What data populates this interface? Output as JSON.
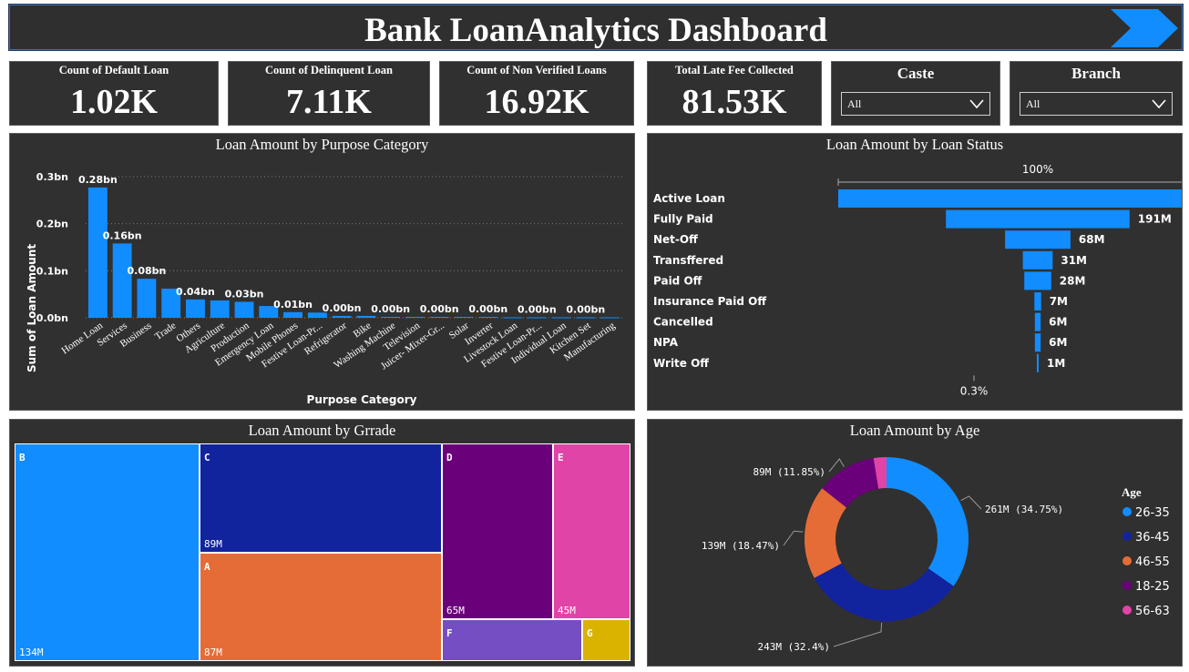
{
  "header": {
    "title": "Bank LoanAnalytics Dashboard"
  },
  "kpis": [
    {
      "label": "Count of Default Loan",
      "value": "1.02K"
    },
    {
      "label": "Count of Delinquent Loan",
      "value": "7.11K"
    },
    {
      "label": "Count of Non Verified Loans",
      "value": "16.92K"
    },
    {
      "label": "Total Late Fee Collected",
      "value": "81.53K"
    }
  ],
  "slicers": [
    {
      "label": "Caste",
      "value": "All"
    },
    {
      "label": "Branch",
      "value": "All"
    }
  ],
  "colors": {
    "blue": "#118dff",
    "navy": "#12239e",
    "orange": "#e66c37",
    "purple": "#6b007b",
    "pink": "#e044a7",
    "violet": "#744ec2",
    "gold": "#d9b300"
  },
  "charts": {
    "purpose": {
      "title": "Loan Amount by Purpose Category"
    },
    "status": {
      "title": "Loan Amount by Loan Status"
    },
    "grade": {
      "title": "Loan Amount by Grrade"
    },
    "age": {
      "title": "Loan Amount by Age"
    }
  },
  "chart_data": [
    {
      "type": "bar",
      "title": "Loan Amount by Purpose Category",
      "xlabel": "Purpose Category",
      "ylabel": "Sum of Loan Amount",
      "ylim": [
        0,
        0.3
      ],
      "yticks": [
        "0.0bn",
        "0.1bn",
        "0.2bn",
        "0.3bn"
      ],
      "grid": true,
      "categories": [
        "Home Loan",
        "Services",
        "Business",
        "Trade",
        "Others",
        "Agriculture",
        "Production",
        "Emergency Loan",
        "Mobile Phones",
        "Festive Loan-Pr...",
        "Refrigerator",
        "Bike",
        "Washing Machine",
        "Television",
        "Juicer- Mixer-Gr...",
        "Solar",
        "Inverter",
        "Livestock Loan",
        "Festive Loan-Pr...",
        "Individual Loan",
        "Kitchen Set",
        "Manufacturing"
      ],
      "values": [
        0.277,
        0.158,
        0.083,
        0.062,
        0.039,
        0.037,
        0.034,
        0.025,
        0.012,
        0.011,
        0.004,
        0.004,
        0.002,
        0.002,
        0.002,
        0.002,
        0.002,
        0.001,
        0.001,
        0.001,
        0.001,
        0.001
      ],
      "data_labels": [
        "0.28bn",
        "0.16bn",
        "0.08bn",
        "",
        "0.04bn",
        "",
        "0.03bn",
        "",
        "0.01bn",
        "",
        "0.00bn",
        "",
        "0.00bn",
        "",
        "0.00bn",
        "",
        "0.00bn",
        "",
        "0.00bn",
        "",
        "0.00bn",
        ""
      ]
    },
    {
      "type": "bar",
      "title": "Loan Amount by Loan Status",
      "orientation": "funnel",
      "top_percent": "100%",
      "bottom_percent": "0.3%",
      "categories": [
        "Active Loan",
        "Fully Paid",
        "Net-Off",
        "Transffered",
        "Paid Off",
        "Insurance Paid Off",
        "Cancelled",
        "NPA",
        "Write Off"
      ],
      "values": [
        415,
        191,
        68,
        31,
        28,
        7,
        6,
        6,
        1
      ],
      "data_labels": [
        "",
        "191M",
        "68M",
        "31M",
        "28M",
        "7M",
        "6M",
        "6M",
        "1M"
      ]
    },
    {
      "type": "heatmap",
      "subtype": "treemap",
      "title": "Loan Amount by Grrade",
      "categories": [
        "B",
        "C",
        "A",
        "D",
        "E",
        "F",
        "G"
      ],
      "values": [
        134,
        89,
        87,
        65,
        45,
        28,
        9
      ],
      "data_labels": [
        "134M",
        "89M",
        "87M",
        "65M",
        "45M",
        "",
        ""
      ]
    },
    {
      "type": "pie",
      "subtype": "donut",
      "title": "Loan Amount by Age",
      "legend_title": "Age",
      "legend_position": "right",
      "categories": [
        "26-35",
        "36-45",
        "46-55",
        "18-25",
        "56-63"
      ],
      "values": [
        261,
        243,
        139,
        89,
        19
      ],
      "data_labels": [
        "261M (34.75%)",
        "243M (32.4%)",
        "139M (18.47%)",
        "89M (11.85%)",
        ""
      ]
    }
  ]
}
